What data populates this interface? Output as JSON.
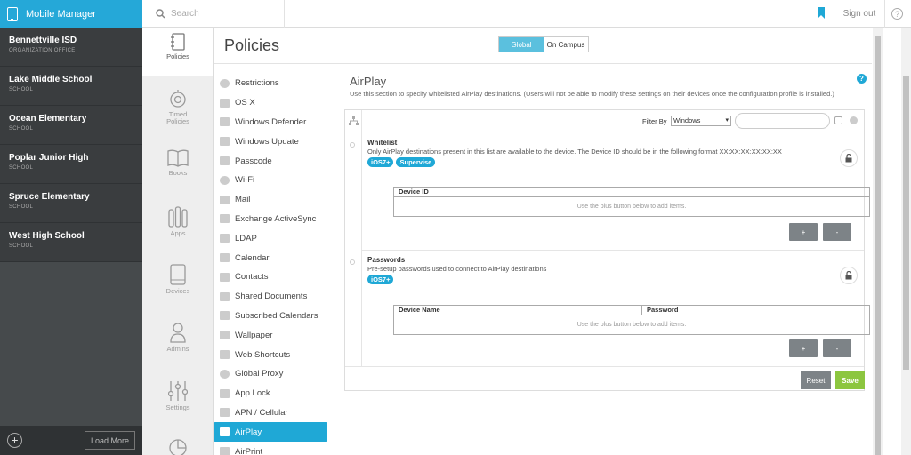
{
  "app": {
    "title": "Mobile Manager",
    "search_placeholder": "Search",
    "signout": "Sign out",
    "help": "?"
  },
  "organizations": [
    {
      "name": "Bennettville ISD",
      "type": "ORGANIZATION OFFICE"
    },
    {
      "name": "Lake Middle School",
      "type": "SCHOOL"
    },
    {
      "name": "Ocean Elementary",
      "type": "SCHOOL"
    },
    {
      "name": "Poplar Junior High",
      "type": "SCHOOL"
    },
    {
      "name": "Spruce Elementary",
      "type": "SCHOOL"
    },
    {
      "name": "West High School",
      "type": "SCHOOL"
    }
  ],
  "org_footer": {
    "add": "+",
    "load_more": "Load More"
  },
  "nav": {
    "policies": "Policies",
    "timed_line1": "Timed",
    "timed_line2": "Policies",
    "books": "Books",
    "apps": "Apps",
    "devices": "Devices",
    "admins": "Admins",
    "settings": "Settings"
  },
  "page": {
    "title": "Policies",
    "segment_global": "Global",
    "segment_campus": "On Campus"
  },
  "policy_list": [
    {
      "label": "Restrictions",
      "icon": "block-icon"
    },
    {
      "label": "OS X",
      "icon": "monitor-icon"
    },
    {
      "label": "Windows Defender",
      "icon": "grid-icon"
    },
    {
      "label": "Windows Update",
      "icon": "grid-icon"
    },
    {
      "label": "Passcode",
      "icon": "keypad-icon"
    },
    {
      "label": "Wi-Fi",
      "icon": "wifi-icon"
    },
    {
      "label": "Mail",
      "icon": "mail-icon"
    },
    {
      "label": "Exchange ActiveSync",
      "icon": "exchange-icon"
    },
    {
      "label": "LDAP",
      "icon": "user-icon"
    },
    {
      "label": "Calendar",
      "icon": "calendar-icon"
    },
    {
      "label": "Contacts",
      "icon": "contacts-icon"
    },
    {
      "label": "Shared Documents",
      "icon": "documents-icon"
    },
    {
      "label": "Subscribed Calendars",
      "icon": "rss-icon"
    },
    {
      "label": "Wallpaper",
      "icon": "image-icon"
    },
    {
      "label": "Web Shortcuts",
      "icon": "bookmark-icon"
    },
    {
      "label": "Global Proxy",
      "icon": "globe-icon"
    },
    {
      "label": "App Lock",
      "icon": "phone-icon"
    },
    {
      "label": "APN / Cellular",
      "icon": "antenna-icon"
    },
    {
      "label": "AirPlay",
      "icon": "airplay-icon",
      "active": true
    },
    {
      "label": "AirPrint",
      "icon": "printer-icon"
    }
  ],
  "content": {
    "title": "AirPlay",
    "description": "Use this section to specify whitelisted AirPlay destinations. (Users will not be able to modify these settings on their devices once the configuration profile is installed.)",
    "filter_label": "Filter By",
    "filter_value": "Windows",
    "whitelist": {
      "title": "Whitelist",
      "desc": "Only AirPlay destinations present in this list are available to the device. The Device ID should be in the following format XX:XX:XX:XX:XX:XX",
      "badges": [
        "iOS7+",
        "Supervise"
      ],
      "columns": [
        "Device ID"
      ],
      "empty": "Use the plus button below to add items.",
      "add": "+",
      "remove": "-"
    },
    "passwords": {
      "title": "Passwords",
      "desc": "Pre-setup passwords used to connect to AirPlay destinations",
      "badges": [
        "iOS7+"
      ],
      "columns": [
        "Device Name",
        "Password"
      ],
      "empty": "Use the plus button below to add items.",
      "add": "+",
      "remove": "-"
    },
    "reset": "Reset",
    "save": "Save"
  },
  "colors": {
    "accent": "#1fa8d6",
    "brand": "#25a8d8",
    "save": "#8cc63f",
    "sidebar": "#3a3d3f"
  }
}
